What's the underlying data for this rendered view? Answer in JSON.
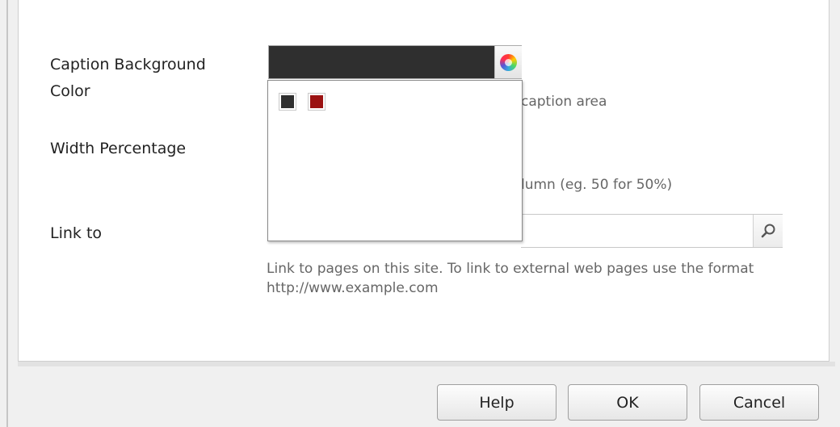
{
  "form": {
    "caption_bg": {
      "label": "Caption Background Color",
      "value_color": "#2f2f2f",
      "picker_icon": "color-wheel-icon",
      "hint": "caption area",
      "palette": [
        {
          "name": "dark-gray",
          "color": "#2f2f2f"
        },
        {
          "name": "dark-red",
          "color": "#9b1212"
        }
      ]
    },
    "width_percentage": {
      "label": "Width Percentage",
      "hint": "lumn (eg. 50 for 50%)"
    },
    "link_to": {
      "label": "Link to",
      "search_icon": "magnifier-icon",
      "hint": "Link to pages on this site. To link to external web pages use the format http://www.example.com"
    }
  },
  "buttons": {
    "help": "Help",
    "ok": "OK",
    "cancel": "Cancel"
  }
}
